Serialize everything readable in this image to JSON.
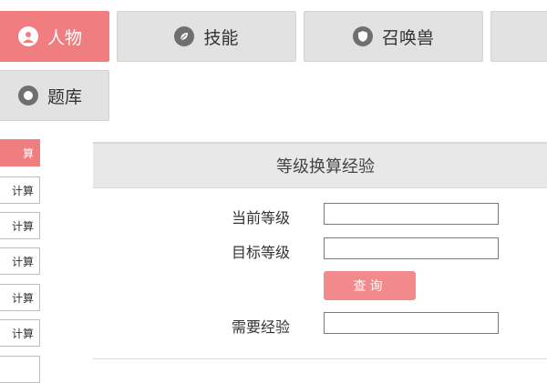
{
  "tabs": [
    {
      "label": "人物",
      "icon": "person-icon",
      "active": true
    },
    {
      "label": "技能",
      "icon": "leaf-icon",
      "active": false
    },
    {
      "label": "召唤兽",
      "icon": "shield-icon",
      "active": false
    },
    {
      "label": "",
      "icon": "",
      "active": false
    },
    {
      "label": "题库",
      "icon": "question-icon",
      "active": false
    }
  ],
  "sidebar": {
    "items": [
      {
        "label": "算",
        "active": true
      },
      {
        "label": "计算",
        "active": false
      },
      {
        "label": "计算",
        "active": false
      },
      {
        "label": "计算",
        "active": false
      },
      {
        "label": "计算",
        "active": false
      },
      {
        "label": "计算",
        "active": false
      }
    ]
  },
  "panel": {
    "title": "等级换算经验",
    "current_level_label": "当前等级",
    "current_level_value": "",
    "target_level_label": "目标等级",
    "target_level_value": "",
    "query_button": "查询",
    "required_exp_label": "需要经验",
    "required_exp_value": ""
  },
  "colors": {
    "accent": "#f07e80",
    "tab_inactive": "#e2e2e2"
  }
}
